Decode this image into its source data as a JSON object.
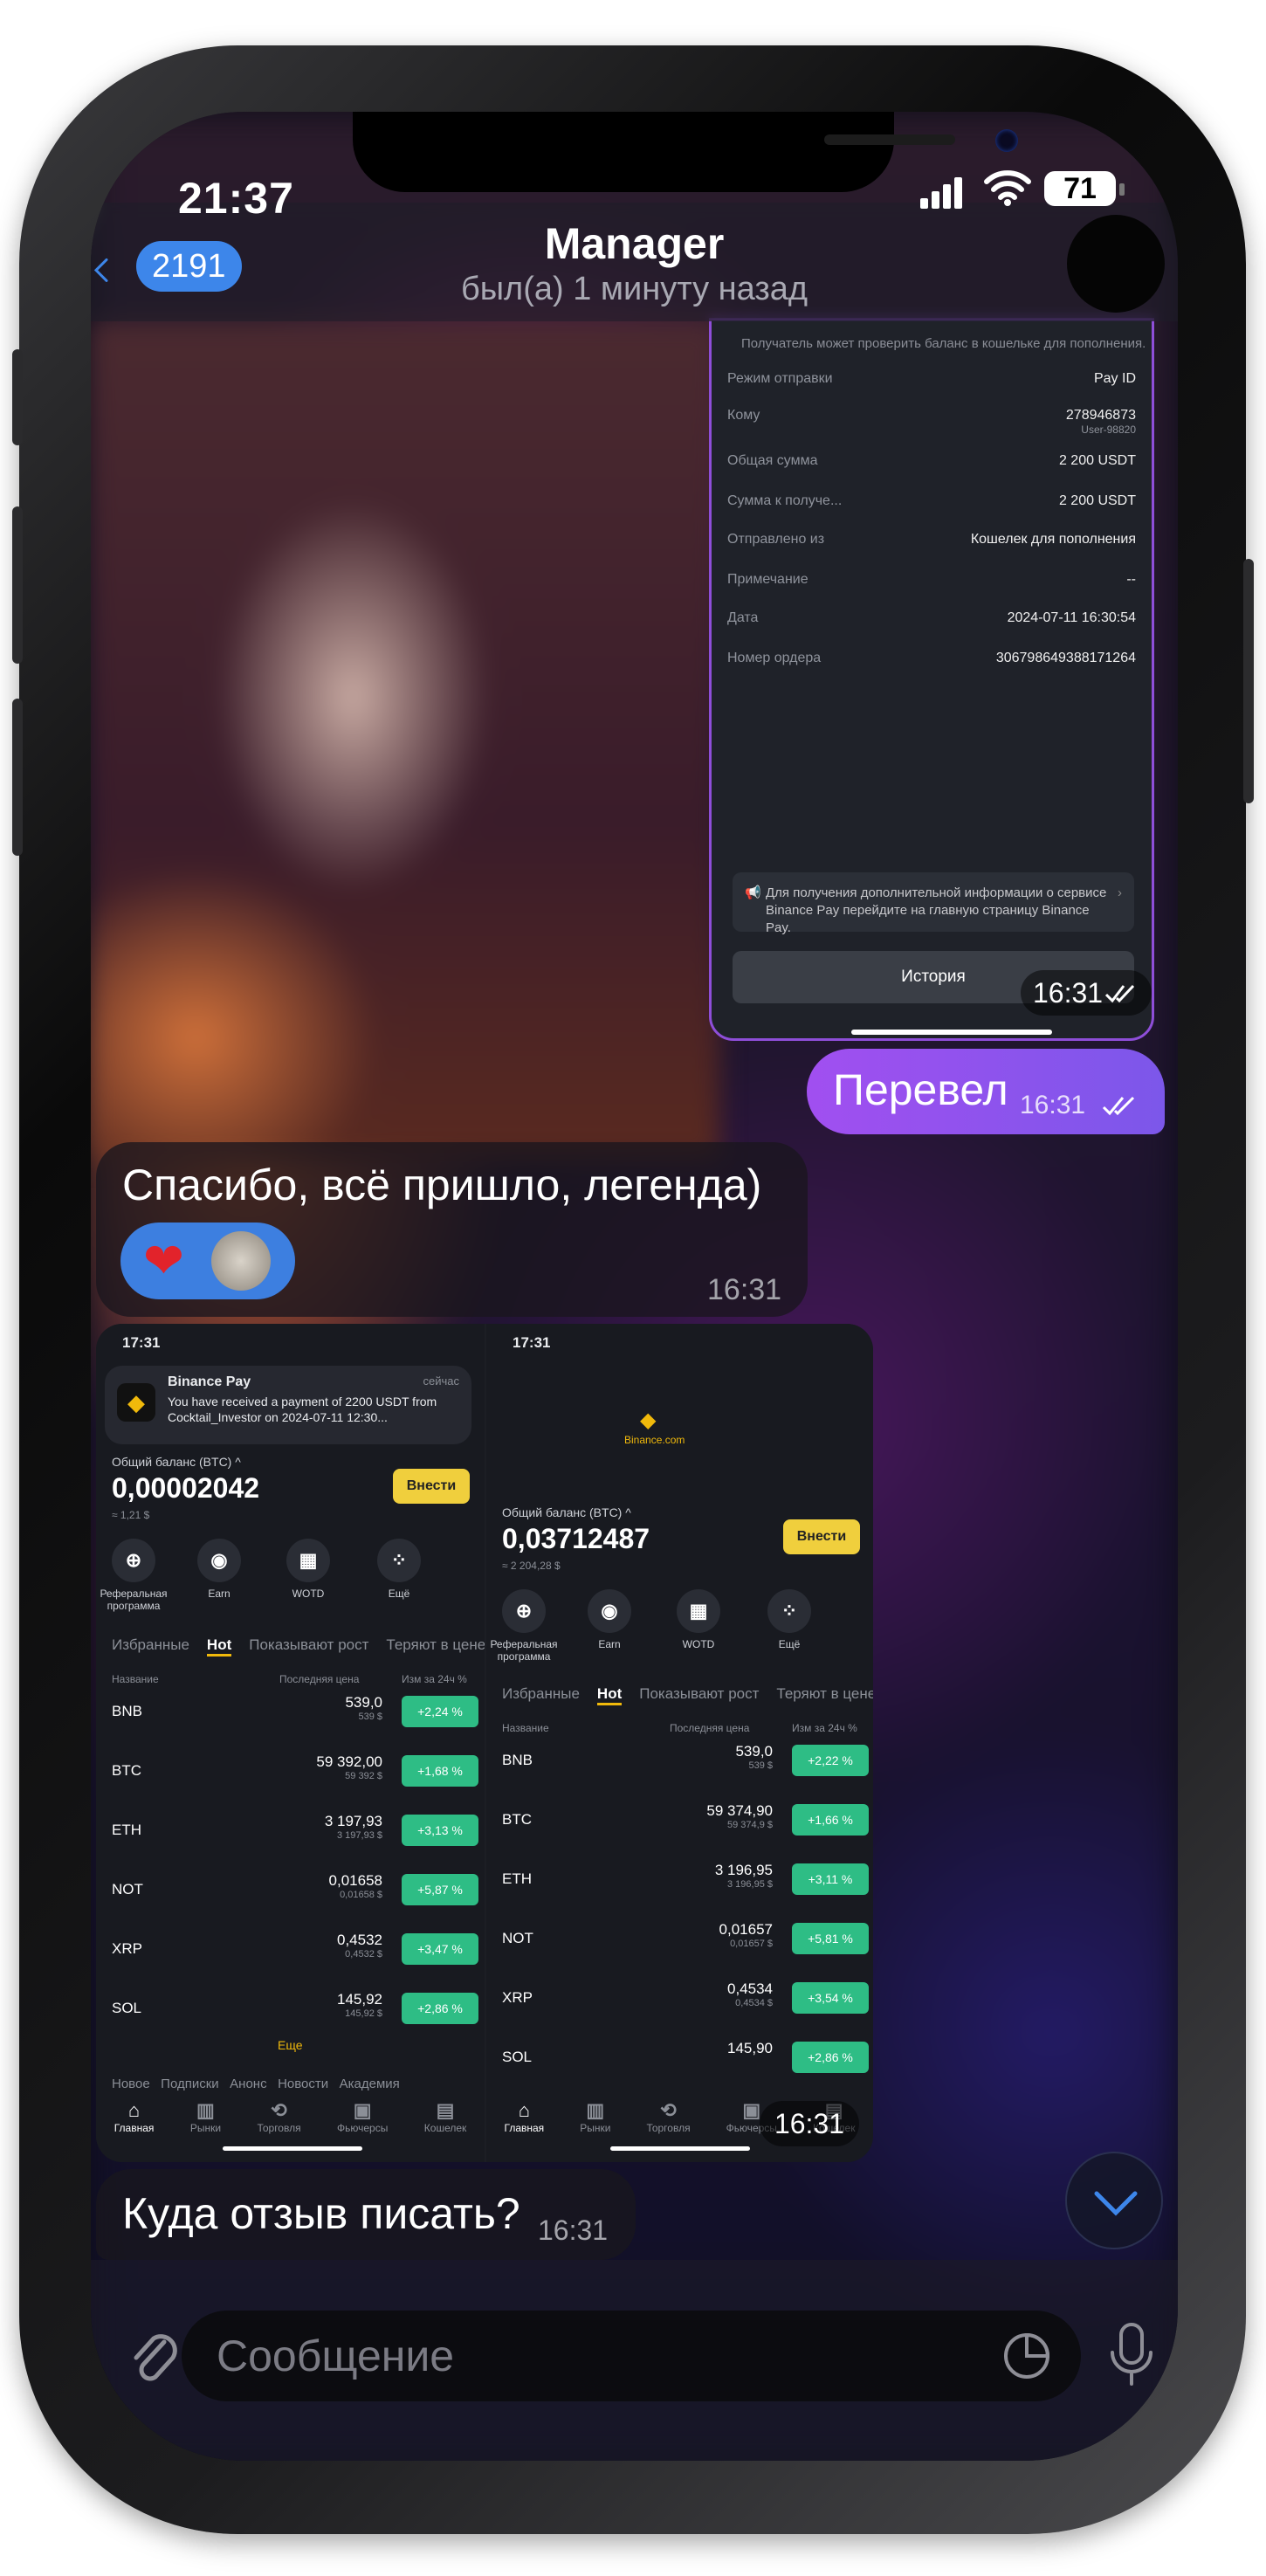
{
  "status": {
    "time": "21:37",
    "battery": "71"
  },
  "header": {
    "back_count": "2191",
    "title": "Manager",
    "subtitle": "был(а) 1 минуту назад"
  },
  "payment_screenshot": {
    "notice": "Получатель может проверить баланс в кошельке для пополнения.",
    "rows": [
      {
        "label": "Режим отправки",
        "value": "Pay ID"
      },
      {
        "label": "Кому",
        "value": "278946873",
        "value2": "User-98820"
      },
      {
        "label": "Общая сумма",
        "value": "2 200 USDT"
      },
      {
        "label": "Сумма к получе...",
        "value": "2 200 USDT"
      },
      {
        "label": "Отправлено из",
        "value": "Кошелек для пополнения"
      },
      {
        "label": "Примечание",
        "value": "--"
      },
      {
        "label": "Дата",
        "value": "2024-07-11 16:30:54"
      },
      {
        "label": "Номер ордера",
        "value": "306798649388171264"
      }
    ],
    "info_text": "Для получения дополнительной информации о сервисе Binance Pay перейдите на главную страницу Binance Pay.",
    "history_button": "История",
    "time": "16:31"
  },
  "messages": {
    "out1": {
      "text": "Перевел",
      "time": "16:31"
    },
    "in1": {
      "text": "Спасибо, всё пришло, легенда)",
      "time": "16:31"
    },
    "album_time": "16:31",
    "in2": {
      "text": "Куда отзыв писать?",
      "time": "16:31"
    }
  },
  "album": {
    "left": {
      "status_time": "17:31",
      "notif_title": "Binance Pay",
      "notif_when": "сейчас",
      "notif_text": "You have received a payment of 2200 USDT from Cocktail_Investor on 2024-07-11 12:30...",
      "balance_label": "Общий баланс (BTC) ^",
      "balance": "0,00002042",
      "balance_usd": "≈ 1,21 $",
      "deposit": "Внести",
      "quick": [
        "Реферальная программа",
        "Earn",
        "WOTD",
        "Ещё"
      ],
      "tabs": [
        "Избранные",
        "Hot",
        "Показывают рост",
        "Теряют в цене"
      ],
      "col_name": "Название",
      "col_price": "Последняя цена",
      "col_change": "Изм за 24ч %",
      "coins": [
        {
          "name": "BNB",
          "price": "539,0",
          "usd": "539 $",
          "change": "+2,24 %"
        },
        {
          "name": "BTC",
          "price": "59 392,00",
          "usd": "59 392 $",
          "change": "+1,68 %"
        },
        {
          "name": "ETH",
          "price": "3 197,93",
          "usd": "3 197,93 $",
          "change": "+3,13 %"
        },
        {
          "name": "NOT",
          "price": "0,01658",
          "usd": "0,01658 $",
          "change": "+5,87 %"
        },
        {
          "name": "XRP",
          "price": "0,4532",
          "usd": "0,4532 $",
          "change": "+3,47 %"
        },
        {
          "name": "SOL",
          "price": "145,92",
          "usd": "145,92 $",
          "change": "+2,86 %"
        }
      ],
      "more": "Еще",
      "news_tabs": "Новое   Подписки   Анонс   Новости   Академия",
      "nav": [
        "Главная",
        "Рынки",
        "Торговля",
        "Фьючерсы",
        "Кошелек"
      ]
    },
    "right": {
      "status_time": "17:31",
      "site": "Binance.com",
      "balance_label": "Общий баланс (BTC) ^",
      "balance": "0,03712487",
      "balance_usd": "≈ 2 204,28 $",
      "deposit": "Внести",
      "quick": [
        "Реферальная программа",
        "Earn",
        "WOTD",
        "Ещё"
      ],
      "tabs": [
        "Избранные",
        "Hot",
        "Показывают рост",
        "Теряют в цене"
      ],
      "col_name": "Название",
      "col_price": "Последняя цена",
      "col_change": "Изм за 24ч %",
      "coins": [
        {
          "name": "BNB",
          "price": "539,0",
          "usd": "539 $",
          "change": "+2,22 %"
        },
        {
          "name": "BTC",
          "price": "59 374,90",
          "usd": "59 374,9 $",
          "change": "+1,66 %"
        },
        {
          "name": "ETH",
          "price": "3 196,95",
          "usd": "3 196,95 $",
          "change": "+3,11 %"
        },
        {
          "name": "NOT",
          "price": "0,01657",
          "usd": "0,01657 $",
          "change": "+5,81 %"
        },
        {
          "name": "XRP",
          "price": "0,4534",
          "usd": "0,4534 $",
          "change": "+3,54 %"
        },
        {
          "name": "SOL",
          "price": "145,90",
          "usd": "",
          "change": "+2,86 %"
        }
      ],
      "nav": [
        "Главная",
        "Рынки",
        "Торговля",
        "Фьючерсы",
        "Кошелек"
      ]
    }
  },
  "composer": {
    "placeholder": "Сообщение"
  },
  "colors": {
    "accent": "#3d86ea",
    "outgoing": "#8d55ee",
    "positive": "#2ebd85",
    "binance": "#f0b90b"
  }
}
